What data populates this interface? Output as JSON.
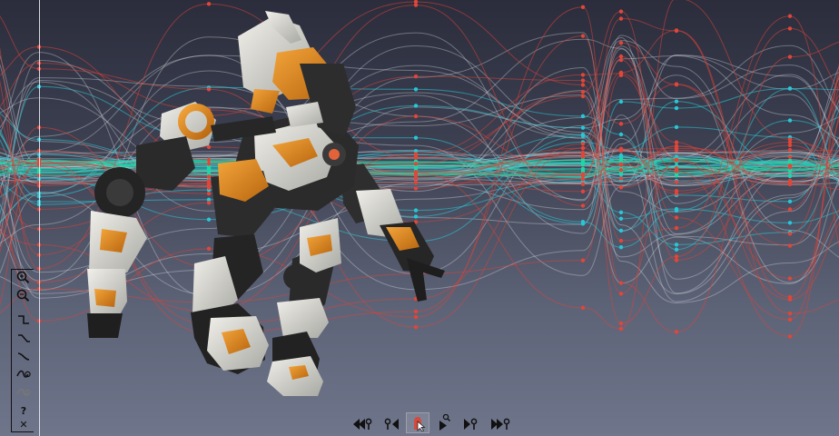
{
  "window": {
    "title": ""
  },
  "colors": {
    "background_top": "#2b2d3c",
    "background_bottom": "#6f758a",
    "curve_white": "#e6e8ee",
    "curve_cyan": "#29c6d6",
    "curve_teal": "#21d6a6",
    "curve_red": "#d7443a",
    "key_red": "#e0463a",
    "playhead": "#e9eaf0",
    "robot_armor": "#d8d8d2",
    "robot_accent": "#e08a1c",
    "robot_dark": "#2b2b2b"
  },
  "toolbar": {
    "tools": [
      {
        "id": "zoom-in",
        "icon": "magnifier-plus-icon"
      },
      {
        "id": "zoom-out",
        "icon": "magnifier-minus-icon"
      },
      {
        "id": "step",
        "icon": "step-tangent-icon"
      },
      {
        "id": "linear",
        "icon": "linear-tangent-icon"
      },
      {
        "id": "smooth",
        "icon": "smooth-tangent-icon"
      },
      {
        "id": "ease",
        "icon": "ease-tangent-icon"
      },
      {
        "id": "auto",
        "icon": "auto-tangent-icon"
      },
      {
        "id": "help",
        "label": "?"
      },
      {
        "id": "close",
        "label": "✕"
      }
    ]
  },
  "transport": {
    "buttons": [
      {
        "id": "first-key",
        "icon": "first-key-icon"
      },
      {
        "id": "prev-key",
        "icon": "previous-key-icon"
      },
      {
        "id": "record",
        "icon": "record-key-icon"
      },
      {
        "id": "play",
        "icon": "play-icon"
      },
      {
        "id": "next-key",
        "icon": "next-key-icon"
      },
      {
        "id": "last-key",
        "icon": "last-key-icon"
      }
    ]
  },
  "keyframe_columns": {
    "description_note": "",
    "times": [
      43,
      230,
      458,
      642,
      684,
      745,
      870
    ]
  }
}
